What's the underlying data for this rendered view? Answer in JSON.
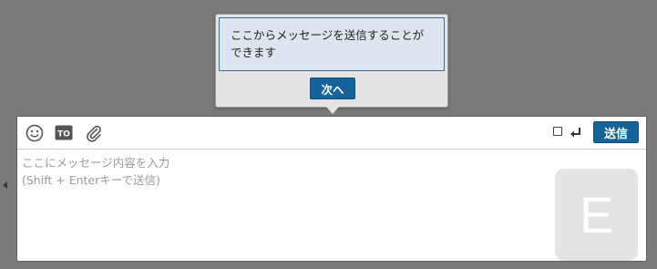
{
  "tooltip": {
    "message": "ここからメッセージを送信することができます",
    "next_label": "次へ"
  },
  "toolbar": {
    "icons": [
      "emoji-icon",
      "to-icon",
      "paperclip-icon",
      "enter-key-icon"
    ],
    "send_label": "送信",
    "enter_to_send_checked": false
  },
  "message_input": {
    "placeholder_line1": "ここにメッセージ内容を入力",
    "placeholder_line2": "(Shift + Enterキーで送信)"
  },
  "avatar": {
    "initial": "E",
    "bg_color": "#e4e4e4"
  },
  "colors": {
    "accent": "#16639a",
    "overlay": "#7a7a7a"
  }
}
